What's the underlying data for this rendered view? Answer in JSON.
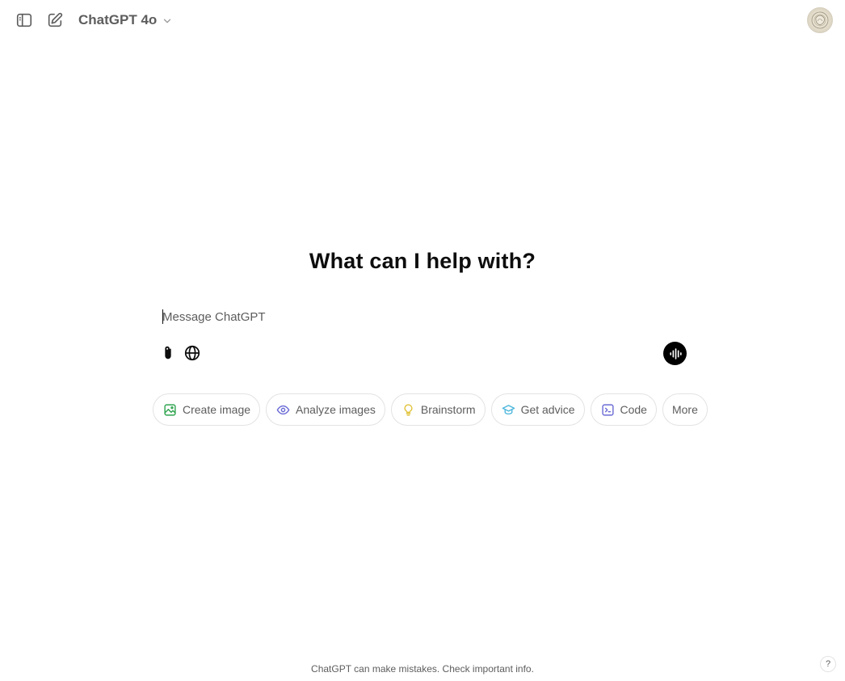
{
  "header": {
    "sidebar_toggle_icon": "sidebar-toggle-icon",
    "new_chat_icon": "pencil-square-icon",
    "model_name": "ChatGPT 4o",
    "model_chevron_icon": "chevron-down-icon",
    "avatar_icon": "user-avatar"
  },
  "main": {
    "headline": "What can I help with?",
    "composer": {
      "placeholder": "Message ChatGPT",
      "value": "",
      "attach_icon": "paperclip-icon",
      "search_icon": "globe-icon",
      "voice_icon": "voice-waveform-icon"
    },
    "suggestions": [
      {
        "label": "Create image",
        "icon": "image-icon",
        "color": "#2fa44f"
      },
      {
        "label": "Analyze images",
        "icon": "eye-icon",
        "color": "#6b6bd6"
      },
      {
        "label": "Brainstorm",
        "icon": "lightbulb-icon",
        "color": "#e2c541"
      },
      {
        "label": "Get advice",
        "icon": "graduation-cap-icon",
        "color": "#4fb7dd"
      },
      {
        "label": "Code",
        "icon": "terminal-icon",
        "color": "#6b6bd6"
      },
      {
        "label": "More",
        "icon": "",
        "color": ""
      }
    ]
  },
  "footer": {
    "disclaimer": "ChatGPT can make mistakes. Check important info.",
    "help_label": "?"
  },
  "colors": {
    "text_primary": "#0d0d0d",
    "text_secondary": "#5d5d5d",
    "border": "#e3e3e3",
    "background": "#ffffff",
    "voice_button": "#000000"
  }
}
